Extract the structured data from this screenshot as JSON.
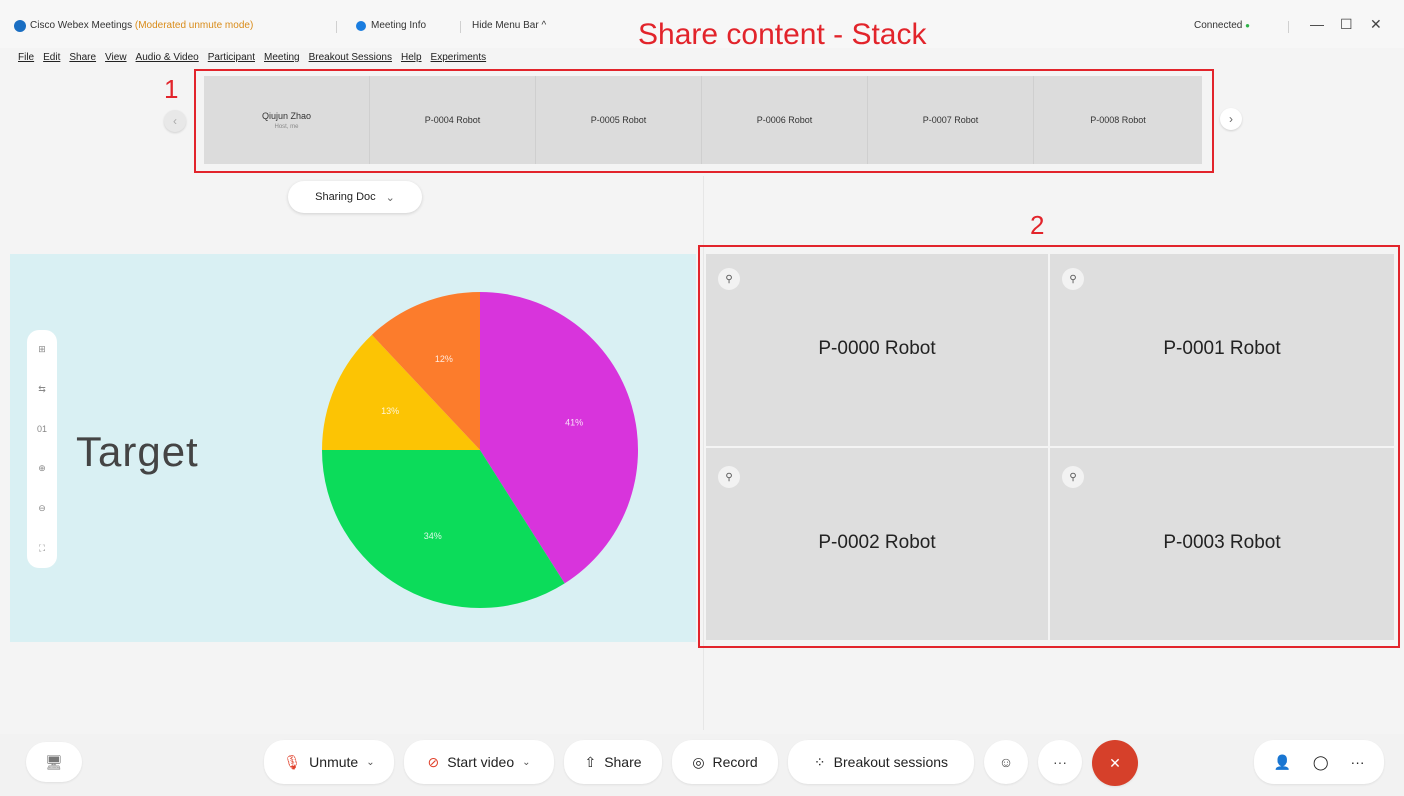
{
  "titlebar": {
    "app_name": "Cisco Webex Meetings",
    "mode": "(Moderated unmute mode)",
    "meeting_info": "Meeting Info",
    "hide_menu": "Hide Menu Bar",
    "hide_menu_glyph": "^",
    "status": "Connected",
    "status_dot": "●",
    "minimize": "—",
    "maximize": "☐",
    "close": "✕"
  },
  "menu": [
    "File",
    "Edit",
    "Share",
    "View",
    "Audio & Video",
    "Participant",
    "Meeting",
    "Breakout Sessions",
    "Help",
    "Experiments"
  ],
  "annotations": {
    "title": "Share content - Stack",
    "box1_label": "1",
    "box2_label": "2"
  },
  "filmstrip": {
    "prev_glyph": "‹",
    "next_glyph": "›",
    "tiles": [
      {
        "name": "Qiujun Zhao",
        "sub": "Host, me"
      },
      {
        "name": "P-0004 Robot",
        "sub": ""
      },
      {
        "name": "P-0005 Robot",
        "sub": ""
      },
      {
        "name": "P-0006 Robot",
        "sub": ""
      },
      {
        "name": "P-0007 Robot",
        "sub": ""
      },
      {
        "name": "P-0008 Robot",
        "sub": ""
      }
    ]
  },
  "sharing": {
    "label": "Sharing Doc",
    "chevron": "⌄"
  },
  "slide": {
    "target_text": "Target",
    "zoom_controls": [
      "⊞",
      "⇆",
      "01",
      "⊕",
      "⊖",
      "⛶"
    ]
  },
  "chart_data": {
    "type": "pie",
    "values": [
      41,
      34,
      13,
      12
    ],
    "labels": [
      "41%",
      "34%",
      "13%",
      "12%"
    ],
    "colors": [
      "#d834dc",
      "#0cdc5a",
      "#fcc404",
      "#fc7c2c"
    ]
  },
  "video_grid": {
    "pin_glyph": "⚲",
    "tiles": [
      "P-0000 Robot",
      "P-0001 Robot",
      "P-0002 Robot",
      "P-0003 Robot"
    ]
  },
  "bottom_bar": {
    "device_icon": "🖥",
    "unmute": "Unmute",
    "unmute_icon": "🎙",
    "start_video": "Start video",
    "video_icon": "⊘",
    "share": "Share",
    "share_icon": "⇧",
    "record": "Record",
    "record_icon": "◎",
    "breakout": "Breakout sessions",
    "breakout_icon": "⁘",
    "emoji_icon": "☺",
    "more_icon": "···",
    "end_icon": "✕",
    "participants_icon": "👤",
    "chat_icon": "◯",
    "more_right_icon": "···",
    "dropdown_glyph": "⌄"
  }
}
